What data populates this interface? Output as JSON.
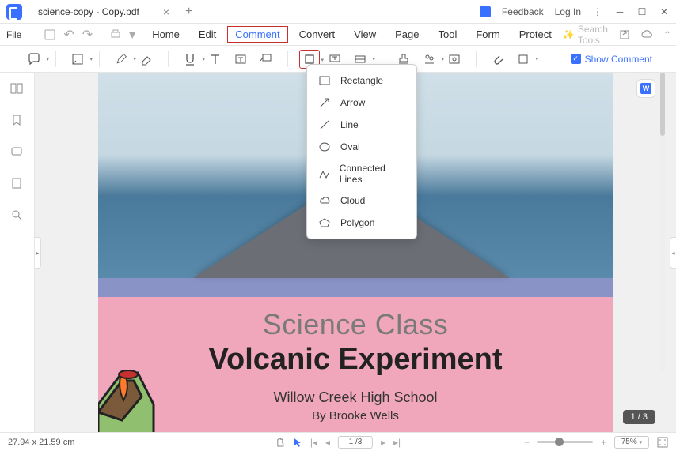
{
  "titlebar": {
    "tab_title": "science-copy - Copy.pdf",
    "feedback": "Feedback",
    "login": "Log In"
  },
  "filemenu": "File",
  "menus": [
    "Home",
    "Edit",
    "Comment",
    "Convert",
    "View",
    "Page",
    "Tool",
    "Form",
    "Protect"
  ],
  "active_menu_index": 2,
  "search_placeholder": "Search Tools",
  "ribbon": {
    "show_comment": "Show Comment"
  },
  "shapes": [
    {
      "label": "Rectangle",
      "icon": "rect"
    },
    {
      "label": "Arrow",
      "icon": "arrow"
    },
    {
      "label": "Line",
      "icon": "line"
    },
    {
      "label": "Oval",
      "icon": "oval"
    },
    {
      "label": "Connected Lines",
      "icon": "conn"
    },
    {
      "label": "Cloud",
      "icon": "cloud"
    },
    {
      "label": "Polygon",
      "icon": "poly"
    }
  ],
  "document": {
    "title1": "Science Class",
    "title2": "Volcanic Experiment",
    "subtitle1": "Willow Creek High School",
    "subtitle2": "By Brooke Wells"
  },
  "page_indicator": "1 / 3",
  "status": {
    "dimensions": "27.94 x 21.59 cm",
    "page_box": "1 /3",
    "zoom": "75%"
  }
}
